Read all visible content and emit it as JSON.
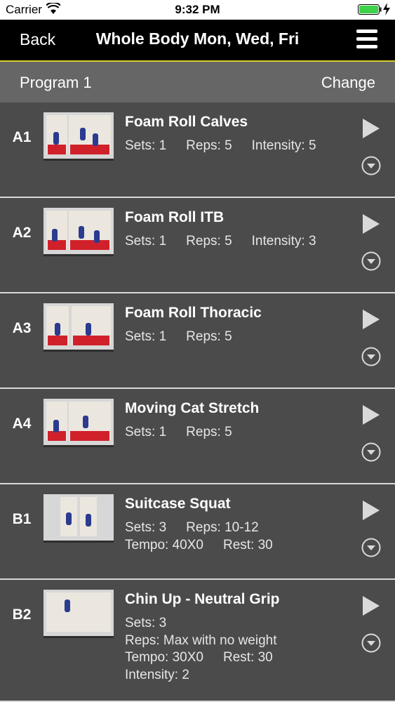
{
  "status_bar": {
    "carrier": "Carrier",
    "time": "9:32 PM",
    "battery_color": "#3cd24a"
  },
  "nav": {
    "back_label": "Back",
    "title": "Whole Body Mon, Wed, Fri",
    "accent_color": "#d9cc2a"
  },
  "program": {
    "name": "Program 1",
    "change_label": "Change"
  },
  "exercises": [
    {
      "code": "A1",
      "name": "Foam Roll Calves",
      "lines": [
        [
          "Sets: 1",
          "Reps: 5",
          "Intensity: 5"
        ]
      ]
    },
    {
      "code": "A2",
      "name": "Foam Roll ITB",
      "lines": [
        [
          "Sets: 1",
          "Reps: 5",
          "Intensity: 3"
        ]
      ]
    },
    {
      "code": "A3",
      "name": "Foam Roll Thoracic",
      "lines": [
        [
          "Sets: 1",
          "Reps: 5"
        ]
      ]
    },
    {
      "code": "A4",
      "name": "Moving Cat Stretch",
      "lines": [
        [
          "Sets: 1",
          "Reps: 5"
        ]
      ]
    },
    {
      "code": "B1",
      "name": "Suitcase Squat",
      "lines": [
        [
          "Sets: 3",
          "Reps: 10-12"
        ],
        [
          "Tempo: 40X0",
          "Rest: 30"
        ]
      ]
    },
    {
      "code": "B2",
      "name": "Chin Up - Neutral Grip",
      "lines": [
        [
          "Sets: 3"
        ],
        [
          "Reps: Max with no weight"
        ],
        [
          "Tempo: 30X0",
          "Rest: 30"
        ],
        [
          "Intensity: 2"
        ]
      ]
    }
  ],
  "icons": {
    "play": "play-icon",
    "expand": "chevron-down-circle-icon",
    "menu": "hamburger-menu-icon"
  }
}
